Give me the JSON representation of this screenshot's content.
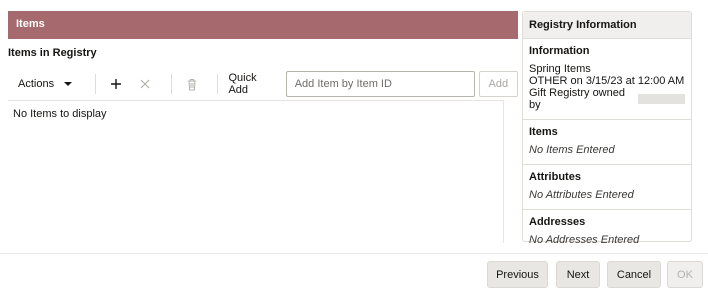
{
  "items_panel": {
    "header": "Items",
    "subheader": "Items in Registry",
    "toolbar": {
      "actions_label": "Actions",
      "add_icon": "plus-icon",
      "remove_icon": "close-icon",
      "delete_icon": "trash-icon",
      "quick_add_label": "Quick Add",
      "quick_add_placeholder": "Add Item by Item ID",
      "add_button": "Add"
    },
    "empty_message": "No Items to display"
  },
  "registry_info": {
    "title": "Registry Information",
    "information": {
      "heading": "Information",
      "name": "Spring Items",
      "event_line": "OTHER on 3/15/23 at 12:00 AM",
      "owner_label": "Gift Registry owned by"
    },
    "items": {
      "heading": "Items",
      "value": "No Items Entered"
    },
    "attributes": {
      "heading": "Attributes",
      "value": "No Attributes Entered"
    },
    "addresses": {
      "heading": "Addresses",
      "value": "No Addresses Entered"
    }
  },
  "footer": {
    "previous": "Previous",
    "next": "Next",
    "cancel": "Cancel",
    "ok": "OK"
  },
  "colors": {
    "header_bg": "#a66a6e",
    "panel_title_bg": "#f1efed"
  }
}
